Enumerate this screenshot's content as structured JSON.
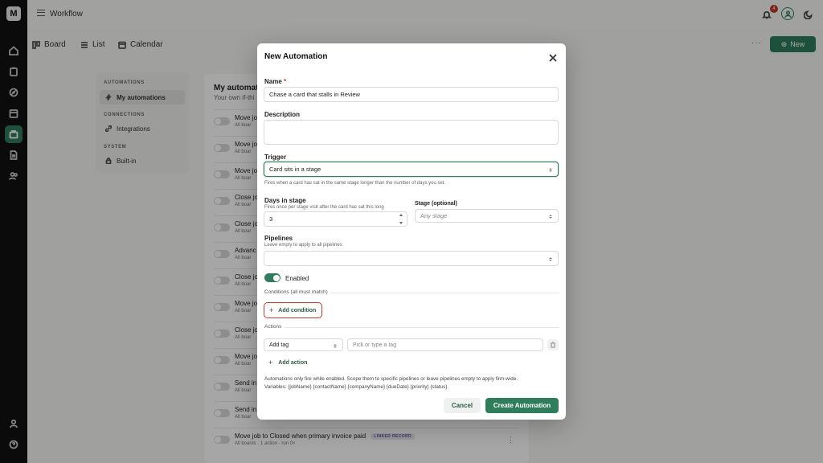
{
  "app": {
    "logo_letter": "M",
    "title": "Workflow",
    "notification_count": "4"
  },
  "views": {
    "board": "Board",
    "list": "List",
    "calendar": "Calendar",
    "more": "···",
    "new_button": "New"
  },
  "subnav": {
    "automations_header": "AUTOMATIONS",
    "my_automations": "My automations",
    "connections_header": "CONNECTIONS",
    "integrations": "Integrations",
    "system_header": "SYSTEM",
    "built_in": "Built-in"
  },
  "list_panel": {
    "title": "My automat",
    "subtitle": "Your own if-thi",
    "rules": [
      {
        "name": "Move jo",
        "meta": "All boar"
      },
      {
        "name": "Move jo",
        "meta": "All boar"
      },
      {
        "name": "Move jo",
        "meta": "All boar"
      },
      {
        "name": "Close jo",
        "meta": "All boar"
      },
      {
        "name": "Close jo",
        "meta": "All boar"
      },
      {
        "name": "Advanc",
        "meta": "All boar"
      },
      {
        "name": "Close jo",
        "meta": "All boar"
      },
      {
        "name": "Move jo",
        "meta": "All boar"
      },
      {
        "name": "Close jo",
        "meta": "All boar"
      },
      {
        "name": "Move jo",
        "meta": "All boar"
      },
      {
        "name": "Send in",
        "meta": "All boar"
      },
      {
        "name": "Send in",
        "meta": "All boar"
      }
    ],
    "last_rule": {
      "name": "Move job to Closed when primary invoice paid",
      "pill": "LINKED RECORD",
      "meta": "All boards · 1 action · run 0×"
    }
  },
  "modal": {
    "title": "New Automation",
    "name_label": "Name",
    "name_required": "*",
    "name_value": "Chase a card that stalls in Review",
    "description_label": "Description",
    "trigger_label": "Trigger",
    "trigger_value": "Card sits in a stage",
    "trigger_hint": "Fires when a card has sat in the same stage longer than the number of days you set.",
    "days_label": "Days in stage",
    "days_hint": "Fires once per stage visit after the card has sat this long",
    "days_value": "3",
    "stage_label": "Stage (optional)",
    "stage_value": "Any stage",
    "pipelines_label": "Pipelines",
    "pipelines_hint": "Leave empty to apply to all pipelines",
    "enabled_label": "Enabled",
    "conditions_caption": "Conditions (all must match)",
    "add_condition": "Add condition",
    "actions_caption": "Actions",
    "action_type": "Add tag",
    "tag_placeholder": "Pick or type a tag",
    "add_action": "Add action",
    "footnote_line1": "Automations only fire while enabled. Scope them to specific pipelines or leave pipelines empty to apply firm-wide.",
    "footnote_line2": "Variables: {jobName} {contactName} {companyName} {dueDate} {priority} {status}",
    "cancel": "Cancel",
    "create": "Create Automation"
  },
  "colors": {
    "accent": "#2f7d5b",
    "highlight_border": "#c0392b",
    "rail": "#111111"
  }
}
